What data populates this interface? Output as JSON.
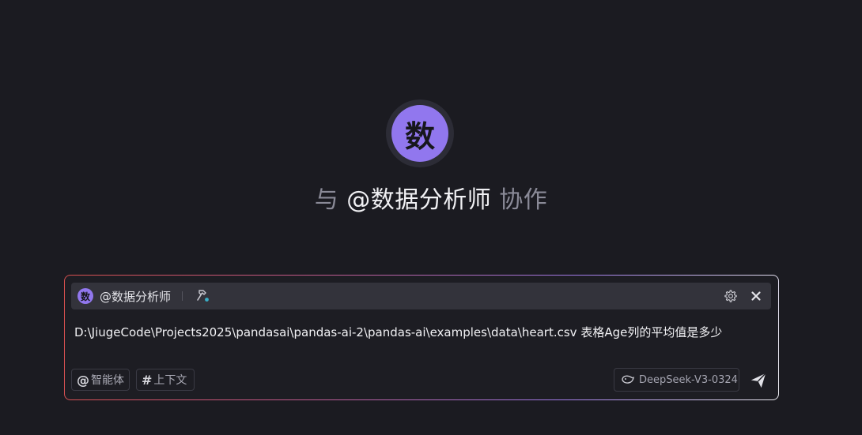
{
  "hero": {
    "avatar_char": "数",
    "prefix": "与",
    "agent": "@数据分析师",
    "suffix": "协作"
  },
  "composer": {
    "agent_bar": {
      "avatar_char": "数",
      "agent_name": "@数据分析师",
      "tools_icon": "hammer-icon",
      "settings_icon": "gear-icon",
      "close_icon": "close-icon"
    },
    "input_value": "D:\\JiugeCode\\Projects2025\\pandasai\\pandas-ai-2\\pandas-ai\\examples\\data\\heart.csv   表格Age列的平均值是多少",
    "chips": [
      {
        "symbol": "@",
        "label": "智能体"
      },
      {
        "symbol": "#",
        "label": "上下文"
      }
    ],
    "model": {
      "icon": "deepseek-whale-icon",
      "label": "DeepSeek-V3-0324"
    },
    "send_icon": "send-icon"
  },
  "colors": {
    "background": "#1b1b21",
    "accent": "#9177ee",
    "border_gradient": [
      "#d9504e",
      "#a07ae8",
      "#e9e9ee"
    ]
  }
}
